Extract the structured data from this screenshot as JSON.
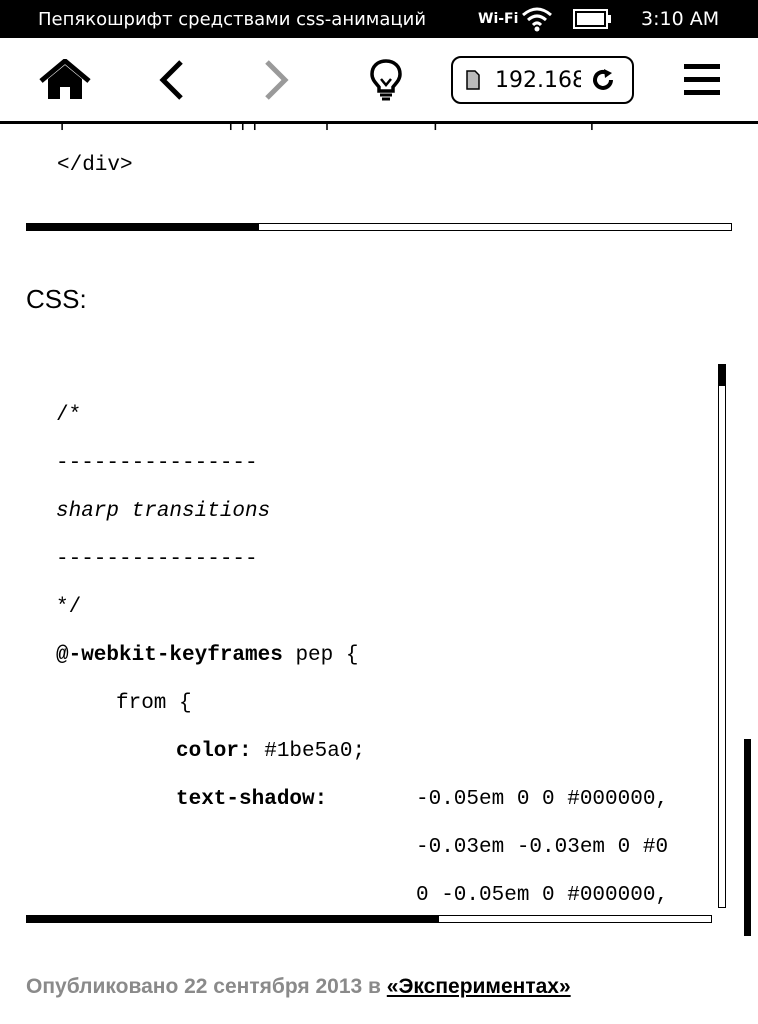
{
  "status_bar": {
    "title": "Пепякошрифт средствами css-анимаций",
    "wifi_label": "Wi-Fi",
    "time": "3:10 AM"
  },
  "toolbar": {
    "url": "192.168",
    "icons": [
      "home-icon",
      "back-arrow-icon",
      "forward-arrow-icon",
      "lightbulb-icon",
      "page-icon",
      "reload-icon",
      "menu-icon"
    ],
    "forward_color": "#9a9a9a"
  },
  "content": {
    "div_close": "</div>",
    "html_scroll_fraction": 0.33,
    "css_heading": "CSS:",
    "code_lines": [
      "/*",
      "----------------",
      "sharp transitions",
      "----------------",
      "*/",
      "@-webkit-keyframes",
      " pep {",
      "from {",
      "color:",
      " #1be5a0;",
      "text-shadow:",
      "-0.05em 0 0 #000000,",
      "-0.03em -0.03em 0 #0",
      "0 -0.05em 0 #000000,"
    ],
    "css_vscroll_fraction": 0.0,
    "css_hscroll_fraction": 0.6,
    "footer": {
      "prefix": "Опубликовано 22 сентября 2013 в ",
      "link": "«Экспериментах»"
    }
  }
}
